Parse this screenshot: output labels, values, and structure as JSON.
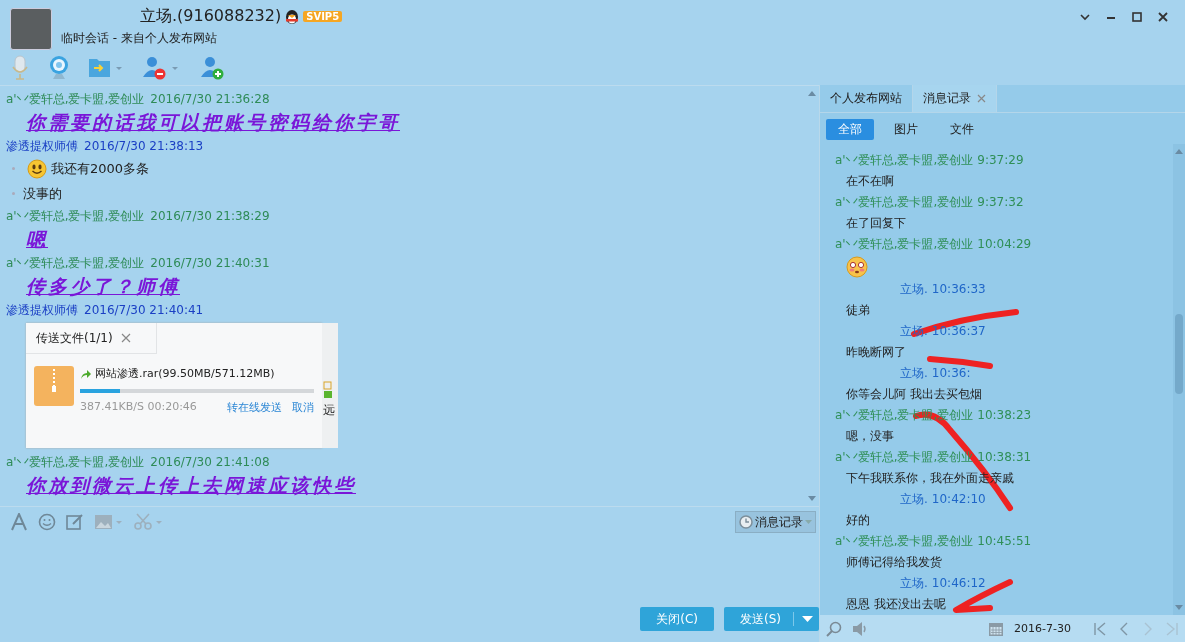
{
  "window": {
    "title": "立场.(916088232)",
    "vip_badge": "SVIP5",
    "subtitle": "临时会话 - 来自个人发布网站"
  },
  "chat": {
    "messages": [
      {
        "sender": "a'丷爱轩总,爱卡盟,爱创业",
        "time": "2016/7/30 21:36:28",
        "color": "#2e8b57",
        "kind": "styled",
        "text": "你需要的话我可以把账号密码给你宇哥"
      },
      {
        "sender": "渗透提权师傅",
        "time": "2016/7/30 21:38:13",
        "color": "#1a3fc4",
        "kind": "plain",
        "lines": [
          {
            "text": "我还有2000多条",
            "smiley": true
          },
          {
            "text": "没事的",
            "smiley": false
          }
        ]
      },
      {
        "sender": "a'丷爱轩总,爱卡盟,爱创业",
        "time": "2016/7/30 21:38:29",
        "color": "#2e8b57",
        "kind": "styled",
        "text": "嗯"
      },
      {
        "sender": "a'丷爱轩总,爱卡盟,爱创业",
        "time": "2016/7/30 21:40:31",
        "color": "#2e8b57",
        "kind": "styled",
        "text": "传多少了？师傅"
      },
      {
        "sender": "渗透提权师傅",
        "time": "2016/7/30 21:40:41",
        "color": "#1a3fc4",
        "kind": "file",
        "file": {
          "title": "传送文件(1/1)",
          "name": "网站渗透.rar(99.50MB/571.12MB)",
          "level": 0.17,
          "speed": "387.41KB/S 00:20:46",
          "actions": [
            "转在线发送",
            "取消"
          ],
          "behind_text": "远"
        }
      },
      {
        "sender": "a'丷爱轩总,爱卡盟,爱创业",
        "time": "2016/7/30 21:41:08",
        "color": "#2e8b57",
        "kind": "styled",
        "text": "你放到微云上传上去网速应该快些"
      }
    ]
  },
  "input_toolbar": {
    "history_button": "消息记录"
  },
  "buttons": {
    "close": "关闭(C)",
    "send": "发送(S)"
  },
  "history_panel": {
    "tabs": [
      {
        "label": "个人发布网站",
        "selected": false,
        "closable": false
      },
      {
        "label": "消息记录",
        "selected": true,
        "closable": true
      }
    ],
    "filters": [
      {
        "label": "全部",
        "selected": true
      },
      {
        "label": "图片",
        "selected": false
      },
      {
        "label": "文件",
        "selected": false
      }
    ],
    "entries": [
      {
        "kind": "incoming",
        "sender": "a'丷爱轩总,爱卡盟,爱创业",
        "time": "9:37:29"
      },
      {
        "kind": "text",
        "text": "在不在啊"
      },
      {
        "kind": "incoming",
        "sender": "a'丷爱轩总,爱卡盟,爱创业",
        "time": "9:37:32"
      },
      {
        "kind": "text",
        "text": "在了回复下"
      },
      {
        "kind": "incoming",
        "sender": "a'丷爱轩总,爱卡盟,爱创业",
        "time": "10:04:29"
      },
      {
        "kind": "emoji"
      },
      {
        "kind": "outgoing",
        "sender": "立场.",
        "time": "10:36:33"
      },
      {
        "kind": "text",
        "text": "徒弟"
      },
      {
        "kind": "outgoing",
        "sender": "立场.",
        "time": "10:36:37"
      },
      {
        "kind": "text",
        "text": "昨晚断网了"
      },
      {
        "kind": "outgoing",
        "sender": "立场.",
        "time": "10:36:"
      },
      {
        "kind": "text",
        "text": "你等会儿阿  我出去买包烟"
      },
      {
        "kind": "incoming",
        "sender": "a'丷爱轩总,爱卡盟,爱创业",
        "time": "10:38:23"
      },
      {
        "kind": "text",
        "text": "嗯，没事"
      },
      {
        "kind": "incoming",
        "sender": "a'丷爱轩总,爱卡盟,爱创业",
        "time": "10:38:31"
      },
      {
        "kind": "text",
        "text": "下午我联系你，我在外面走亲戚"
      },
      {
        "kind": "outgoing",
        "sender": "立场.",
        "time": "10:42:10"
      },
      {
        "kind": "text",
        "text": "好的"
      },
      {
        "kind": "incoming",
        "sender": "a'丷爱轩总,爱卡盟,爱创业",
        "time": "10:45:51"
      },
      {
        "kind": "text",
        "text": "师傅记得给我发货"
      },
      {
        "kind": "outgoing",
        "sender": "立场.",
        "time": "10:46:12"
      },
      {
        "kind": "text",
        "text": "恩恩  我还没出去呢"
      }
    ],
    "date": "2016-7-30"
  }
}
